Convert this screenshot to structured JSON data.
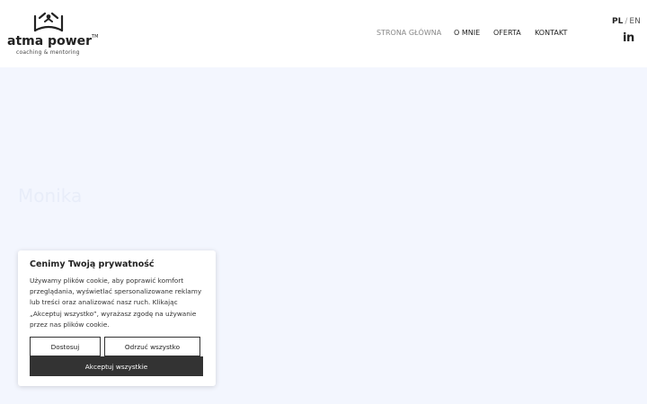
{
  "brand": {
    "name": "atma power",
    "tm": "TM",
    "tagline": "coaching & mentoring"
  },
  "nav": {
    "items": [
      {
        "label": "STRONA GŁÓWNA",
        "active": true
      },
      {
        "label": "O MNIE",
        "active": false
      },
      {
        "label": "OFERTA",
        "active": false
      },
      {
        "label": "KONTAKT",
        "active": false
      }
    ]
  },
  "lang": {
    "current": "PL",
    "separator": "/",
    "other": "EN"
  },
  "social": {
    "linkedin_label": "in",
    "linkedin_icon": "linkedin-icon"
  },
  "hero": {
    "name": "Monika",
    "title_rest": "",
    "subtitle_prefix": "",
    "subtitle_bold": ""
  },
  "cookie": {
    "title": "Cenimy Twoją prywatność",
    "body": "Używamy plików cookie, aby poprawić komfort przeglądania, wyświetlać spersonalizowane reklamy lub treści oraz analizować nasz ruch. Klikając „Akceptuj wszystko”, wyrażasz zgodę na używanie przez nas plików cookie.",
    "customize_label": "Dostosuj",
    "reject_label": "Odrzuć wszystko",
    "accept_label": "Akceptuj wszystkie"
  },
  "colors": {
    "page_bg": "#f3f6fe",
    "header_bg": "#ffffff",
    "accept_bg": "#333333",
    "text": "#222222"
  }
}
